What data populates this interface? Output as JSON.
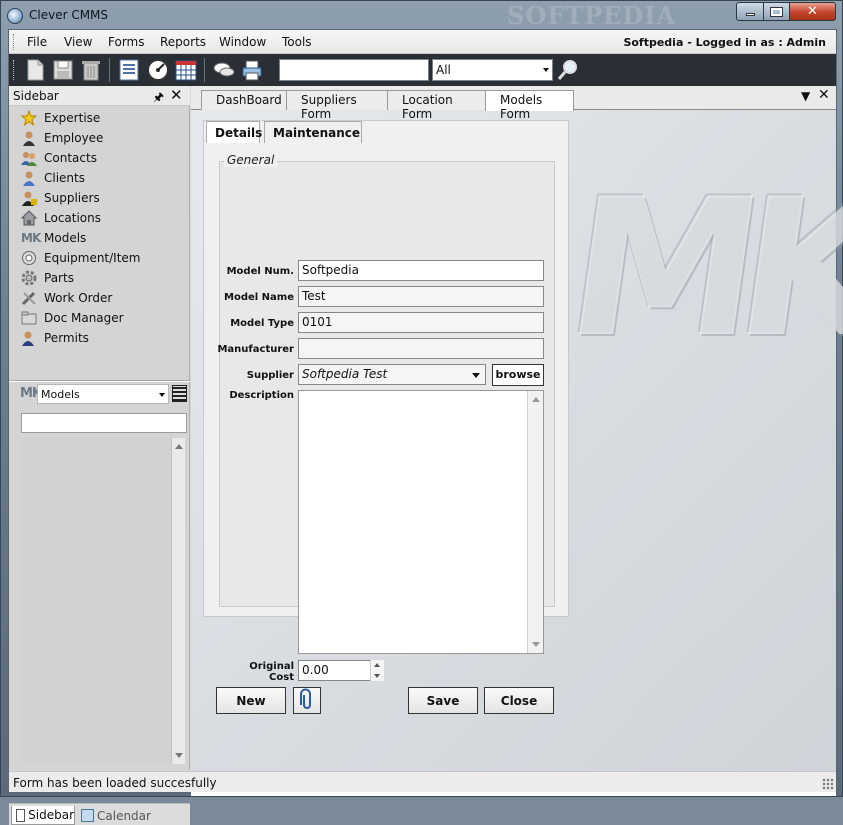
{
  "window": {
    "title": "Clever CMMS",
    "watermark": "SOFTPEDIA"
  },
  "menubar": {
    "items": [
      "File",
      "View",
      "Forms",
      "Reports",
      "Window",
      "Tools"
    ],
    "login_text": "Softpedia - Logged in as :  Admin"
  },
  "toolbar": {
    "search_value": "",
    "filter_value": "All",
    "icons": [
      "new-doc-icon",
      "save-icon",
      "trash-icon",
      "list-icon",
      "dashboard-gauge-icon",
      "calendar-grid-icon",
      "chat-icon",
      "print-icon",
      "magnifier-icon"
    ]
  },
  "sidebar": {
    "title": "Sidebar",
    "items": [
      {
        "label": "Expertise",
        "icon": "star-icon"
      },
      {
        "label": "Employee",
        "icon": "person-icon"
      },
      {
        "label": "Contacts",
        "icon": "people-icon"
      },
      {
        "label": "Clients",
        "icon": "client-icon"
      },
      {
        "label": "Suppliers",
        "icon": "supplier-icon"
      },
      {
        "label": "Locations",
        "icon": "house-icon"
      },
      {
        "label": "Models",
        "icon": "mk-logo-icon"
      },
      {
        "label": "Equipment/Item",
        "icon": "equipment-icon"
      },
      {
        "label": "Parts",
        "icon": "gear-icon"
      },
      {
        "label": "Work Order",
        "icon": "tools-icon"
      },
      {
        "label": "Doc Manager",
        "icon": "folder-icon"
      },
      {
        "label": "Permits",
        "icon": "permit-icon"
      }
    ],
    "combo_value": "Models",
    "search_value": "",
    "tabs": {
      "sidebar": "Sidebar",
      "calendar": "Calendar"
    }
  },
  "doc_tabs": [
    "DashBoard",
    "Suppliers Form",
    "Location Form",
    "Models Form"
  ],
  "form": {
    "tabs": [
      "Details",
      "Maintenance"
    ],
    "group_title": "General",
    "labels": {
      "model_num": "Model Num.",
      "model_name": "Model Name",
      "model_type": "Model Type",
      "manufacturer": "Manufacturer",
      "supplier": "Supplier",
      "description": "Description",
      "original_cost_line1": "Original",
      "original_cost_line2": "Cost"
    },
    "values": {
      "model_num": "Softpedia",
      "model_name": "Test",
      "model_type": "0101",
      "manufacturer": "",
      "supplier": "Softpedia Test",
      "description": "",
      "original_cost": "0.00"
    },
    "browse_label": "browse",
    "buttons": {
      "new": "New",
      "save": "Save",
      "close": "Close"
    }
  },
  "background_logo": "MK",
  "status": {
    "text": "Form has been loaded succesfully"
  }
}
